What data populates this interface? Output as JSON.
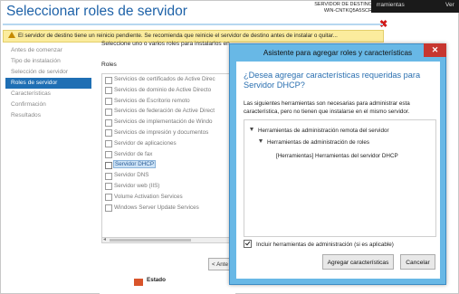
{
  "wizard": {
    "title": "Seleccionar roles de servidor",
    "dest_label": "SERVIDOR DE DESTINO",
    "dest_server": "WIN-CNTKQ5A5SCR",
    "topbar_menu": "rramientas",
    "topbar_menu2": "Ver",
    "warning": "El servidor de destino tiene un reinicio pendiente. Se recomienda que reinicie el servidor de destino antes de instalar o quitar...",
    "nav": [
      "Antes de comenzar",
      "Tipo de instalación",
      "Selección de servidor",
      "Roles de servidor",
      "Características",
      "Confirmación",
      "Resultados"
    ],
    "nav_active_index": 3,
    "instruction": "Seleccione uno o varios roles para instalarlos en",
    "roles_header": "Roles",
    "roles": [
      "Servicios de certificados de Active Direc",
      "Servicios de dominio de Active Directo",
      "Servicios de Escritorio remoto",
      "Servicios de federación de Active Direct",
      "Servicios de implementación de Windo",
      "Servicios de impresión y documentos",
      "Servidor de aplicaciones",
      "Servidor de fax",
      "Servidor DHCP",
      "Servidor DNS",
      "Servidor web (IIS)",
      "Volume Activation Services",
      "Windows Server Update Services"
    ],
    "selected_role_index": 8,
    "prev_button": "< Ante",
    "status_label": "Estado"
  },
  "dialog": {
    "title": "Asistente para agregar roles y características",
    "question": "¿Desea agregar características requeridas para Servidor DHCP?",
    "description": "Las siguientes herramientas son necesarias para administrar esta característica, pero no tienen que instalarse en el mismo servidor.",
    "tree": [
      "Herramientas de administración remota del servidor",
      "Herramientas de administración de roles",
      "[Herramientas] Herramientas del servidor DHCP"
    ],
    "include_tools_label": "Incluir herramientas de administración (si es aplicable)",
    "include_tools_checked": true,
    "add_button": "Agregar características",
    "cancel_button": "Cancelar"
  },
  "colors": {
    "accent": "#1e62a8",
    "nav_active_bg": "#1f6fb4",
    "dialog_frame": "#68b8e6",
    "warning_bg": "#fbec9d",
    "close_button": "#c7362f"
  },
  "icons": [
    "warning-icon",
    "close-icon",
    "expand-triangle-icon",
    "checkbox-icon",
    "scroll-left-icon"
  ]
}
